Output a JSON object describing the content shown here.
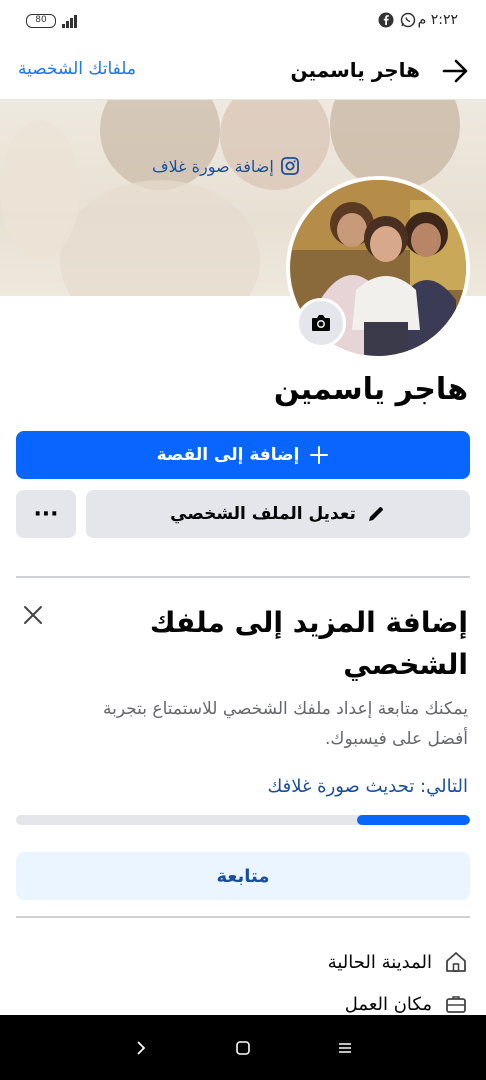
{
  "status": {
    "time": "٢:٢٢ م",
    "battery": "80"
  },
  "header": {
    "title": "هاجر ياسمين",
    "profiles_link": "ملفاتك الشخصية"
  },
  "cover": {
    "add_cover_label": "إضافة صورة غلاف"
  },
  "profile": {
    "name": "هاجر ياسمين"
  },
  "actions": {
    "add_story": "إضافة إلى القصة",
    "edit_profile": "تعديل الملف الشخصي",
    "more": "···"
  },
  "completion_card": {
    "title": "إضافة المزيد إلى ملفك الشخصي",
    "description": "يمكنك متابعة إعداد ملفك الشخصي للاستمتاع بتجربة أفضل على فيسبوك.",
    "next_step": "التالي: تحديث صورة غلافك",
    "progress_fraction": 0.25,
    "continue_button": "متابعة"
  },
  "details": [
    {
      "icon": "home-icon",
      "label": "المدينة الحالية"
    },
    {
      "icon": "briefcase-icon",
      "label": "مكان العمل"
    }
  ],
  "colors": {
    "accent": "#0866ff",
    "link": "#1877f2",
    "button_grey": "#e4e6eb"
  }
}
